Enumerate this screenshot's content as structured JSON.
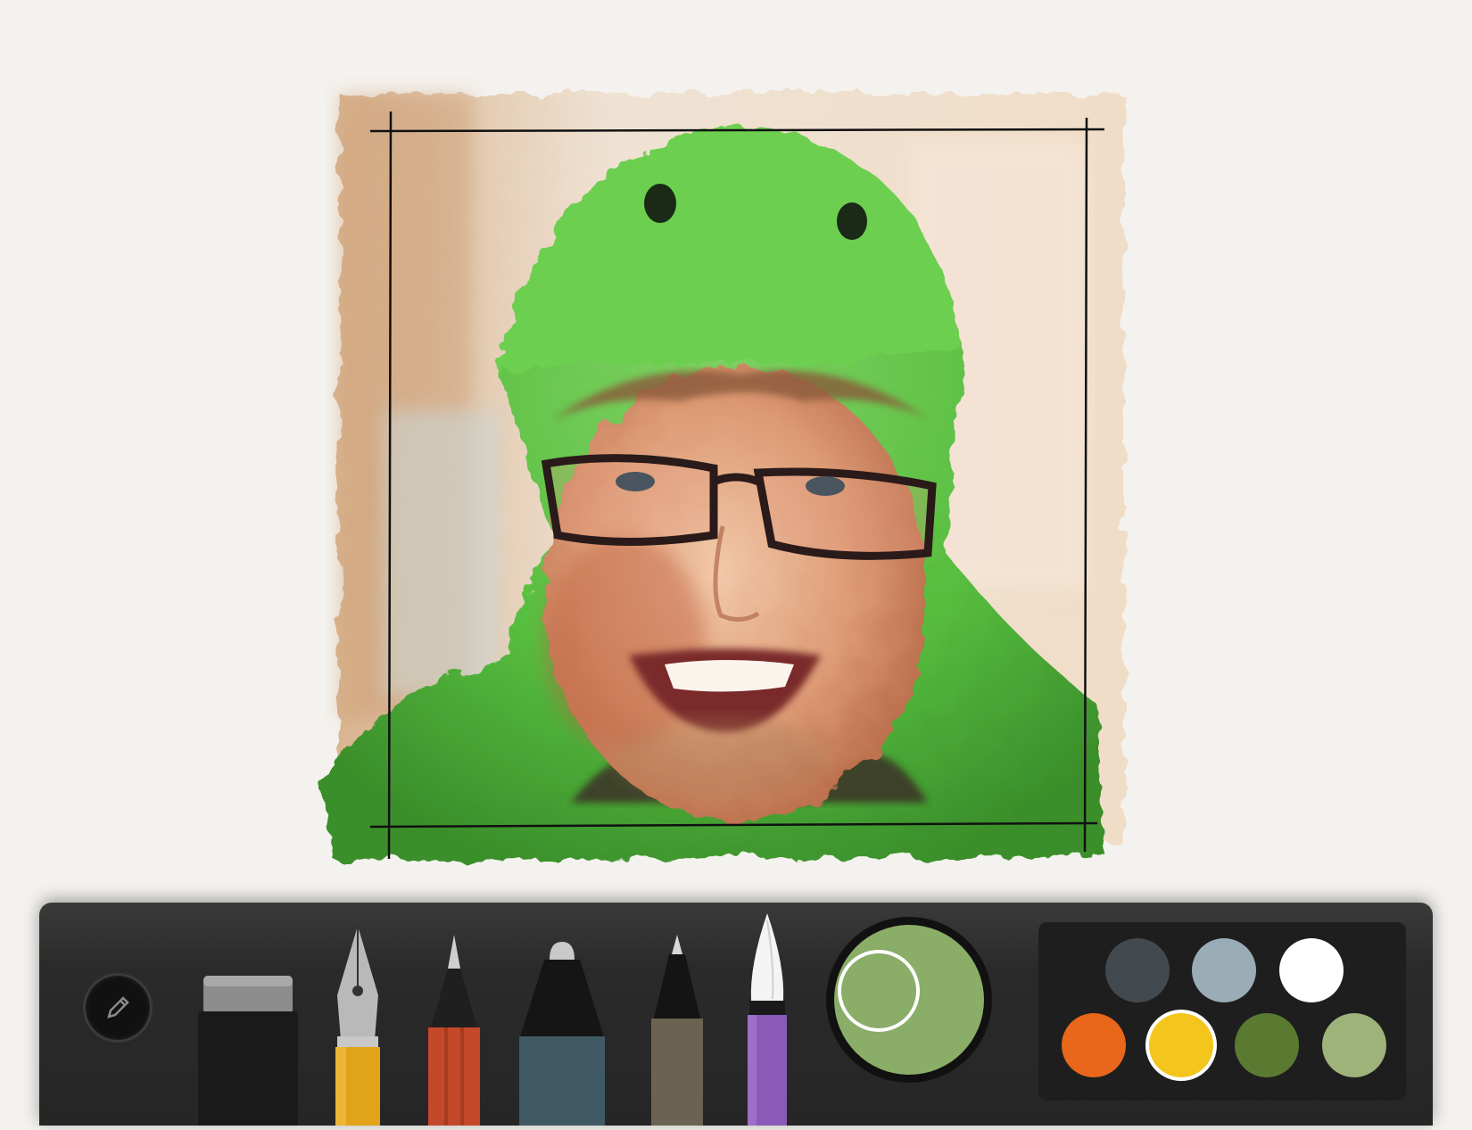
{
  "app": {
    "toolbar": {
      "tools": [
        {
          "name": "eraser",
          "icon": "eraser-icon"
        },
        {
          "name": "fountain-pen",
          "icon": "fountain-pen-icon"
        },
        {
          "name": "pencil",
          "icon": "pencil-icon"
        },
        {
          "name": "marker",
          "icon": "marker-icon"
        },
        {
          "name": "outline-pen",
          "icon": "outline-pen-icon"
        },
        {
          "name": "watercolor-brush",
          "icon": "watercolor-brush-icon",
          "selected": true
        }
      ],
      "current_color": "#8aad68",
      "palette": [
        {
          "color": "#434a4f"
        },
        {
          "color": "#9aadb6"
        },
        {
          "color": "#ffffff"
        },
        {
          "color": "#e8671b"
        },
        {
          "color": "#f3c51d",
          "selected": true
        },
        {
          "color": "#5a7a32"
        },
        {
          "color": "#9db37a"
        }
      ]
    },
    "canvas": {
      "image": "watercolor-portrait-green-dinosaur-hood"
    }
  }
}
